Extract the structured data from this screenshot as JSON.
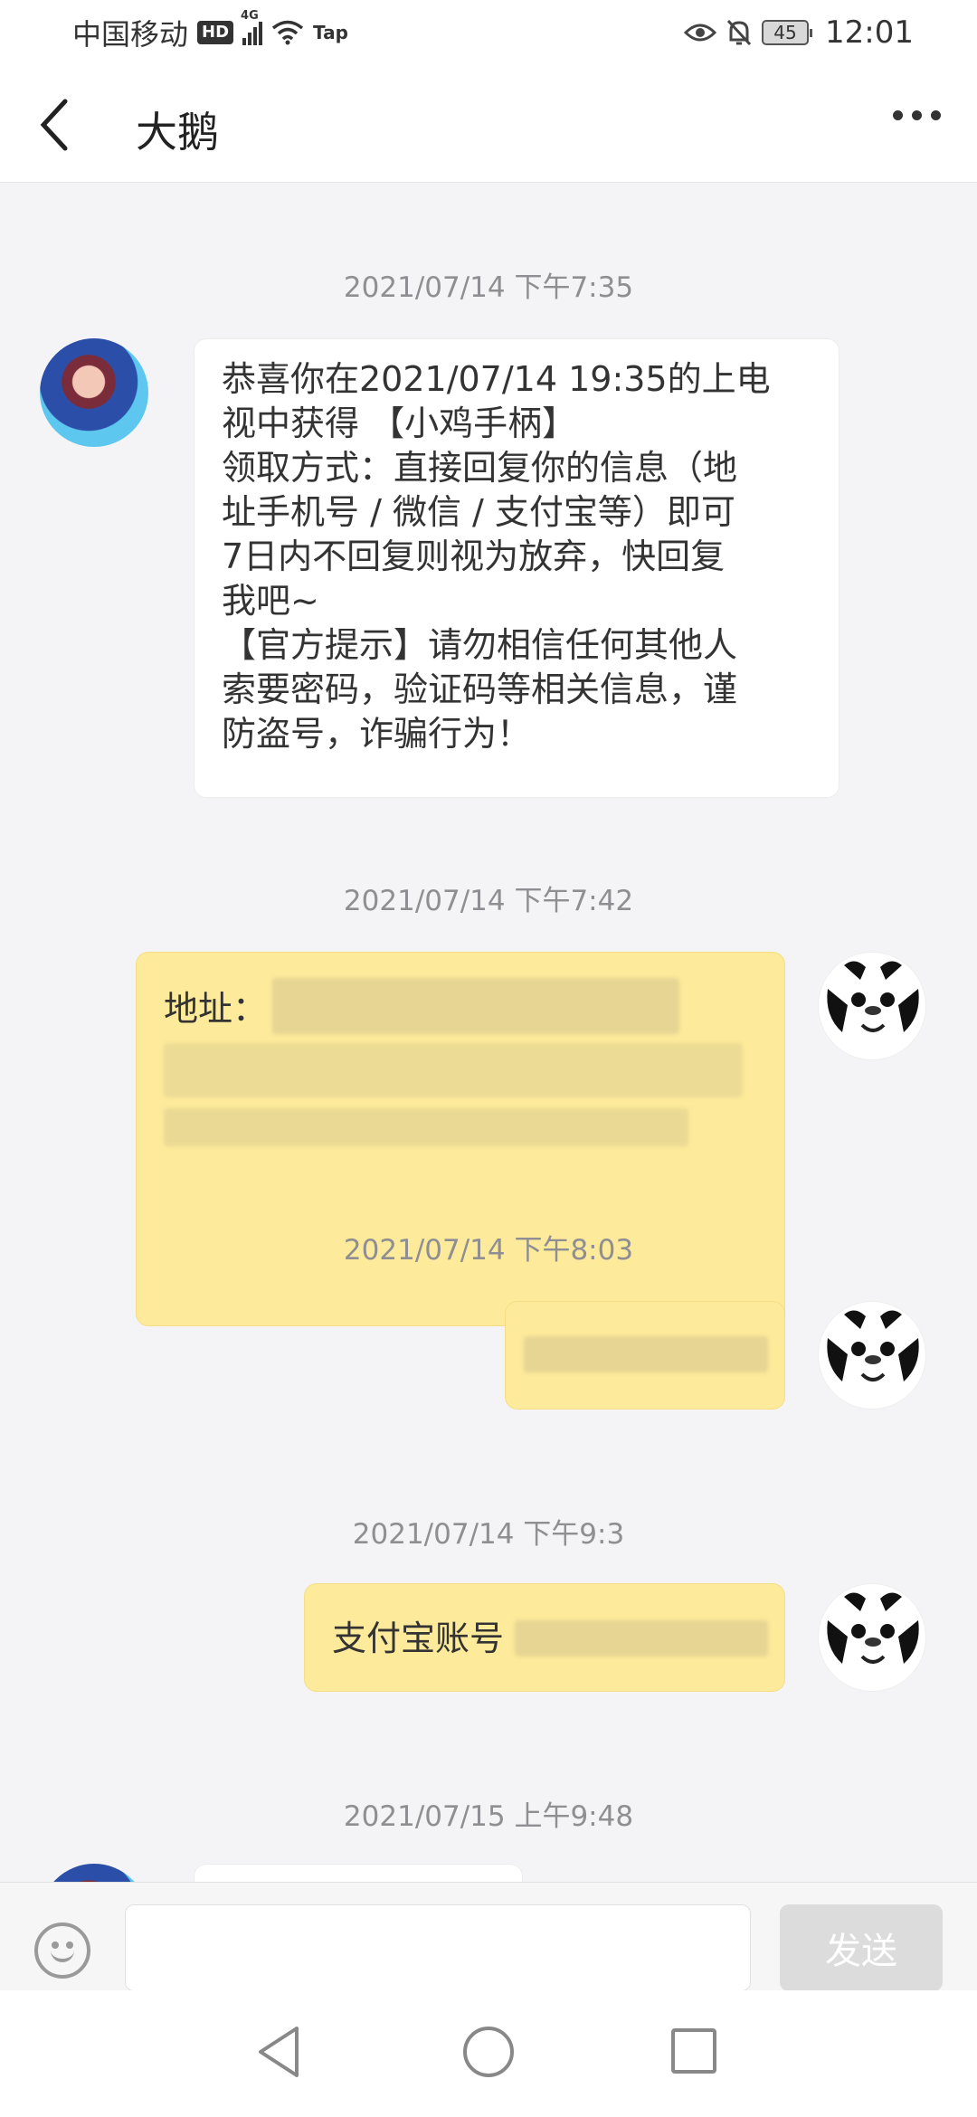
{
  "status_bar": {
    "carrier": "中国移动",
    "hd": "HD",
    "network": "4G",
    "tap": "Tap",
    "battery": "45",
    "time": "12:01"
  },
  "header": {
    "title": "大鹅",
    "back_icon": "chevron-left-icon",
    "more_icon": "more-horizontal-icon"
  },
  "messages": [
    {
      "timestamp": "2021/07/14 下午7:35",
      "sender": "contact",
      "lines": [
        "恭喜你在2021/07/14 19:35的上电",
        "视中获得 【小鸡手柄】",
        "领取方式：直接回复你的信息（地",
        "址手机号 / 微信 / 支付宝等）即可",
        "7日内不回复则视为放弃，快回复",
        "我吧~",
        "【官方提示】请勿相信任何其他人",
        "索要密码，验证码等相关信息，谨",
        "防盗号，诈骗行为！"
      ]
    },
    {
      "timestamp": "2021/07/14 下午7:42",
      "sender": "me",
      "text": "地址："
    },
    {
      "timestamp": "2021/07/14 下午8:03",
      "sender": "me",
      "text": ""
    },
    {
      "timestamp": "2021/07/14 下午9:3",
      "sender": "me",
      "text": "支付宝账号"
    },
    {
      "timestamp": "2021/07/15 上午9:48",
      "sender": "contact",
      "text": ""
    }
  ],
  "input_bar": {
    "emoji_icon": "emoji-smile-icon",
    "placeholder": "",
    "send_label": "发送"
  },
  "nav_bar": {
    "back_icon": "triangle-back-icon",
    "home_icon": "circle-home-icon",
    "recent_icon": "square-recent-icon"
  },
  "colors": {
    "outgoing_bubble": "#fdea9a",
    "incoming_bubble": "#ffffff",
    "chat_background": "#f4f4f6",
    "timestamp": "#8e8e93",
    "send_disabled": "#dcdcdc"
  }
}
